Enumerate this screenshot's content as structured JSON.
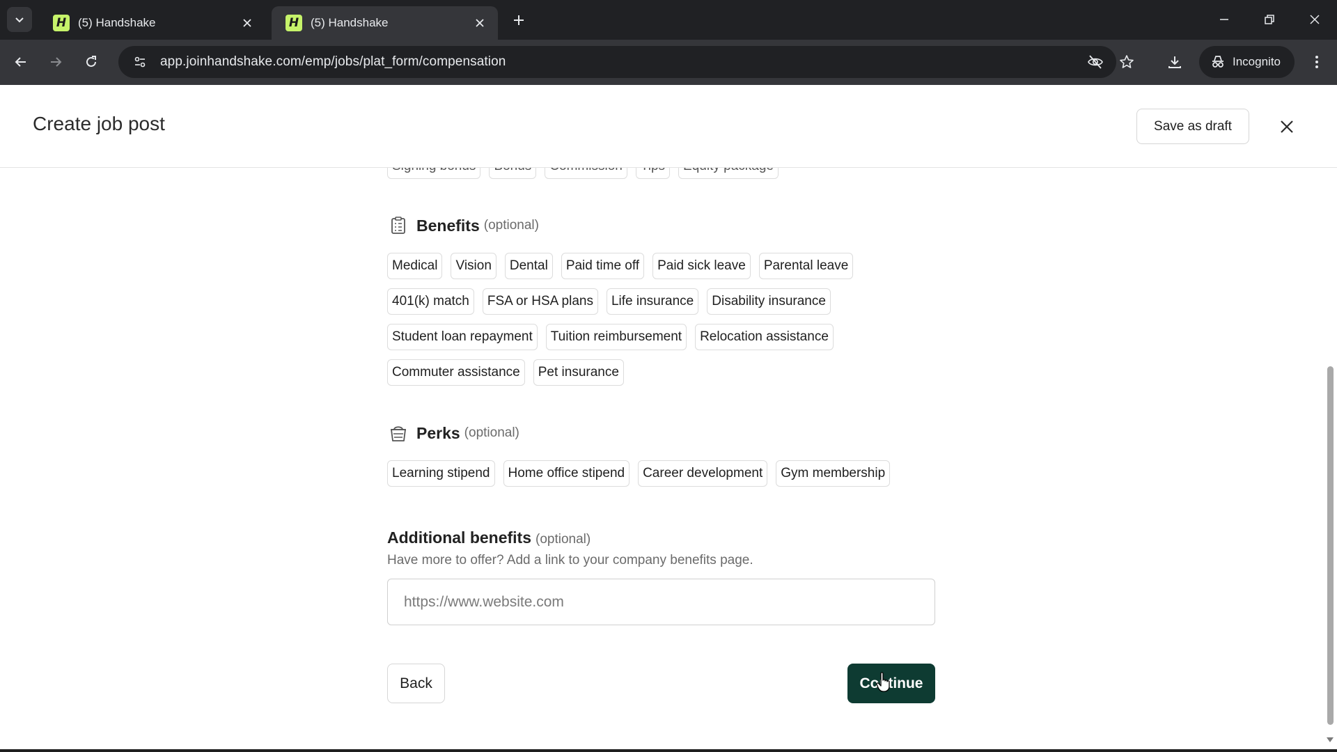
{
  "browser": {
    "tabs": [
      {
        "title": "(5) Handshake",
        "favicon": "H",
        "active": false
      },
      {
        "title": "(5) Handshake",
        "favicon": "H",
        "active": true
      }
    ],
    "url": "app.joinhandshake.com/emp/jobs/plat_form/compensation",
    "incognito_label": "Incognito"
  },
  "header": {
    "title": "Create job post",
    "save_draft_label": "Save as draft"
  },
  "clipped_row": [
    "Signing bonus",
    "Bonus",
    "Commission",
    "Tips",
    "Equity package"
  ],
  "benefits": {
    "title": "Benefits",
    "optional": "(optional)",
    "rows": [
      [
        "Medical",
        "Vision",
        "Dental",
        "Paid time off",
        "Paid sick leave",
        "Parental leave"
      ],
      [
        "401(k) match",
        "FSA or HSA plans",
        "Life insurance",
        "Disability insurance"
      ],
      [
        "Student loan repayment",
        "Tuition reimbursement",
        "Relocation assistance"
      ],
      [
        "Commuter assistance",
        "Pet insurance"
      ]
    ]
  },
  "perks": {
    "title": "Perks",
    "optional": "(optional)",
    "items": [
      "Learning stipend",
      "Home office stipend",
      "Career development",
      "Gym membership"
    ]
  },
  "additional": {
    "title": "Additional benefits",
    "optional": "(optional)",
    "description": "Have more to offer? Add a link to your company benefits page.",
    "placeholder": "https://www.website.com",
    "value": ""
  },
  "footer": {
    "back_label": "Back",
    "continue_label": "Continue"
  },
  "colors": {
    "continue_bg": "#0e3b32",
    "favicon_bg": "#c6f36a",
    "chrome_dark": "#202124"
  }
}
